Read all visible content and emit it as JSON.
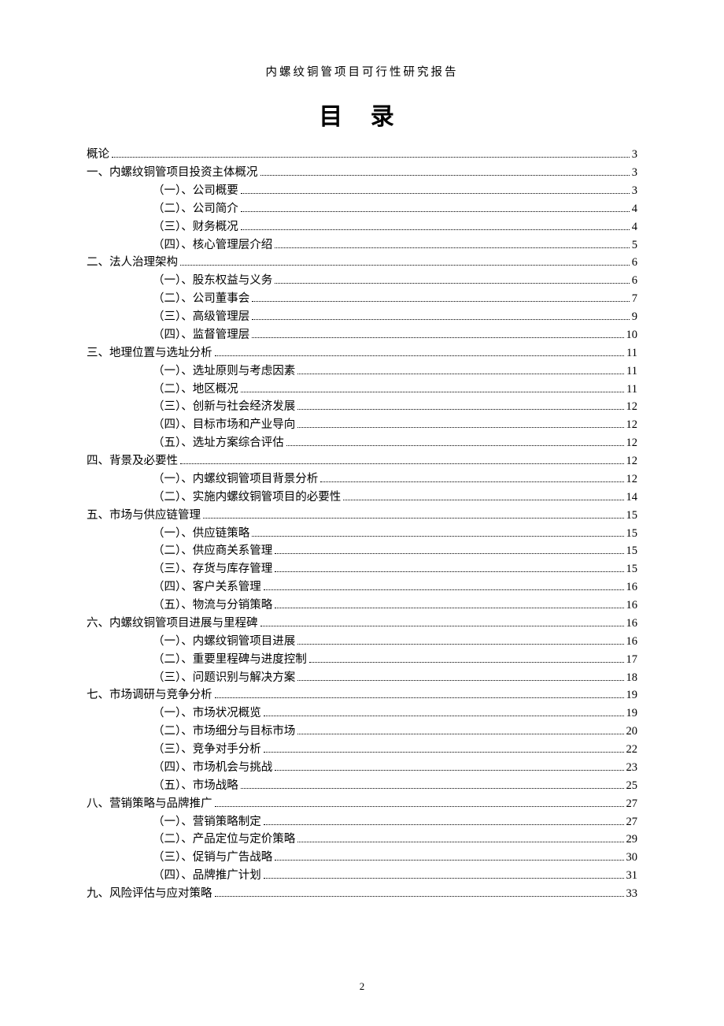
{
  "header": "内螺纹铜管项目可行性研究报告",
  "title": "目 录",
  "page_number": "2",
  "toc": [
    {
      "level": 0,
      "label": "概论",
      "page": "3"
    },
    {
      "level": 0,
      "label": "一、内螺纹铜管项目投资主体概况",
      "page": "3"
    },
    {
      "level": 1,
      "label": "（一）、公司概要",
      "page": "3"
    },
    {
      "level": 1,
      "label": "（二）、公司简介",
      "page": "4"
    },
    {
      "level": 1,
      "label": "（三）、财务概况",
      "page": "4"
    },
    {
      "level": 1,
      "label": "（四）、核心管理层介绍",
      "page": "5"
    },
    {
      "level": 0,
      "label": "二、法人治理架构",
      "page": "6"
    },
    {
      "level": 1,
      "label": "（一）、股东权益与义务",
      "page": "6"
    },
    {
      "level": 1,
      "label": "（二）、公司董事会",
      "page": "7"
    },
    {
      "level": 1,
      "label": "（三）、高级管理层",
      "page": "9"
    },
    {
      "level": 1,
      "label": "（四）、监督管理层",
      "page": "10"
    },
    {
      "level": 0,
      "label": "三、地理位置与选址分析",
      "page": "11"
    },
    {
      "level": 1,
      "label": "（一）、选址原则与考虑因素",
      "page": "11"
    },
    {
      "level": 1,
      "label": "（二）、地区概况",
      "page": "11"
    },
    {
      "level": 1,
      "label": "（三）、创新与社会经济发展",
      "page": "12"
    },
    {
      "level": 1,
      "label": "（四）、目标市场和产业导向",
      "page": "12"
    },
    {
      "level": 1,
      "label": "（五）、选址方案综合评估",
      "page": "12"
    },
    {
      "level": 0,
      "label": "四、背景及必要性",
      "page": "12"
    },
    {
      "level": 1,
      "label": "（一）、内螺纹铜管项目背景分析",
      "page": "12"
    },
    {
      "level": 1,
      "label": "（二）、实施内螺纹铜管项目的必要性",
      "page": "14"
    },
    {
      "level": 0,
      "label": "五、市场与供应链管理",
      "page": "15"
    },
    {
      "level": 1,
      "label": "（一）、供应链策略",
      "page": "15"
    },
    {
      "level": 1,
      "label": "（二）、供应商关系管理",
      "page": "15"
    },
    {
      "level": 1,
      "label": "（三）、存货与库存管理",
      "page": "15"
    },
    {
      "level": 1,
      "label": "（四）、客户关系管理",
      "page": "16"
    },
    {
      "level": 1,
      "label": "（五）、物流与分销策略",
      "page": "16"
    },
    {
      "level": 0,
      "label": "六、内螺纹铜管项目进展与里程碑",
      "page": "16"
    },
    {
      "level": 1,
      "label": "（一）、内螺纹铜管项目进展",
      "page": "16"
    },
    {
      "level": 1,
      "label": "（二）、重要里程碑与进度控制",
      "page": "17"
    },
    {
      "level": 1,
      "label": "（三）、问题识别与解决方案",
      "page": "18"
    },
    {
      "level": 0,
      "label": "七、市场调研与竞争分析",
      "page": "19"
    },
    {
      "level": 1,
      "label": "（一）、市场状况概览",
      "page": "19"
    },
    {
      "level": 1,
      "label": "（二）、市场细分与目标市场",
      "page": "20"
    },
    {
      "level": 1,
      "label": "（三）、竞争对手分析",
      "page": "22"
    },
    {
      "level": 1,
      "label": "（四）、市场机会与挑战",
      "page": "23"
    },
    {
      "level": 1,
      "label": "（五）、市场战略",
      "page": "25"
    },
    {
      "level": 0,
      "label": "八、营销策略与品牌推广",
      "page": "27"
    },
    {
      "level": 1,
      "label": "（一）、营销策略制定",
      "page": "27"
    },
    {
      "level": 1,
      "label": "（二）、产品定位与定价策略",
      "page": "29"
    },
    {
      "level": 1,
      "label": "（三）、促销与广告战略",
      "page": "30"
    },
    {
      "level": 1,
      "label": "（四）、品牌推广计划",
      "page": "31"
    },
    {
      "level": 0,
      "label": "九、风险评估与应对策略",
      "page": "33"
    }
  ]
}
